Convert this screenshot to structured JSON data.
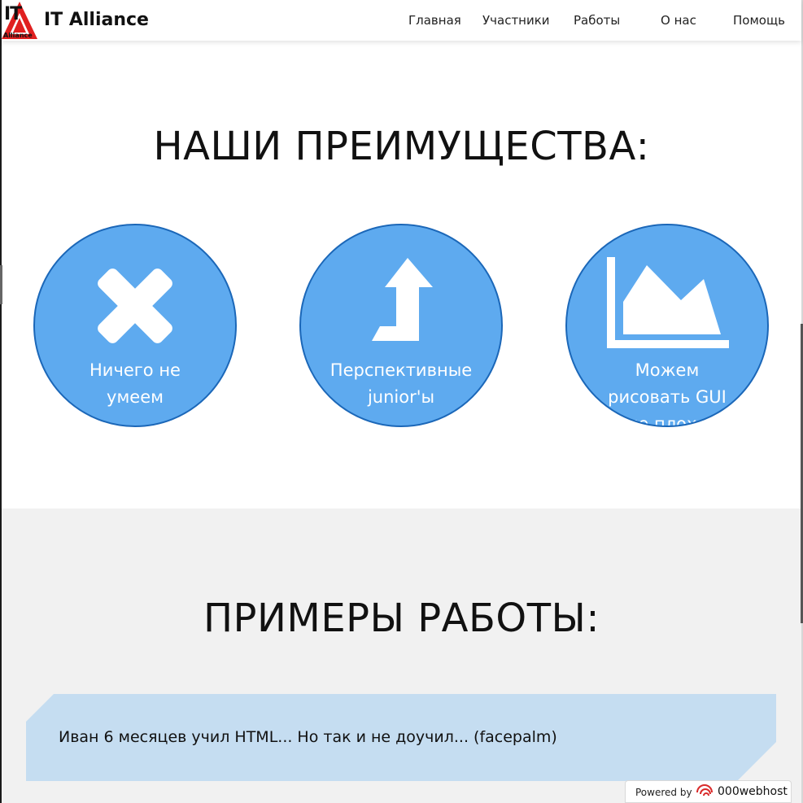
{
  "header": {
    "logo_text": "IT",
    "logo_subtext": "Alliance",
    "brand": "IT Alliance",
    "nav": [
      "Главная",
      "Участники",
      "Работы",
      "О нас",
      "Помощь"
    ]
  },
  "advantages": {
    "title": "НАШИ ПРЕИМУЩЕСТВА:",
    "items": [
      {
        "icon": "x-icon",
        "label_lines": [
          "Ничего не",
          "умеем"
        ]
      },
      {
        "icon": "turn-up-arrow-icon",
        "label_lines": [
          "Перспективные",
          "junior'ы"
        ]
      },
      {
        "icon": "area-chart-icon",
        "label_lines": [
          "Можем",
          "рисовать GUI",
          "не плохо"
        ]
      }
    ]
  },
  "works": {
    "title": "ПРИМЕРЫ РАБОТЫ:",
    "card_text": "Иван 6 месяцев учил HTML... Но так и не доучил... (facepalm)"
  },
  "footer_badge": {
    "powered_by": "Powered by",
    "host": "000webhost"
  },
  "colors": {
    "circle_fill": "#5eaaef",
    "circle_border": "#1b67b8",
    "card_fill": "#c5ddf1",
    "gray_bg": "#f1f1f1",
    "logo_red": "#e02020"
  }
}
